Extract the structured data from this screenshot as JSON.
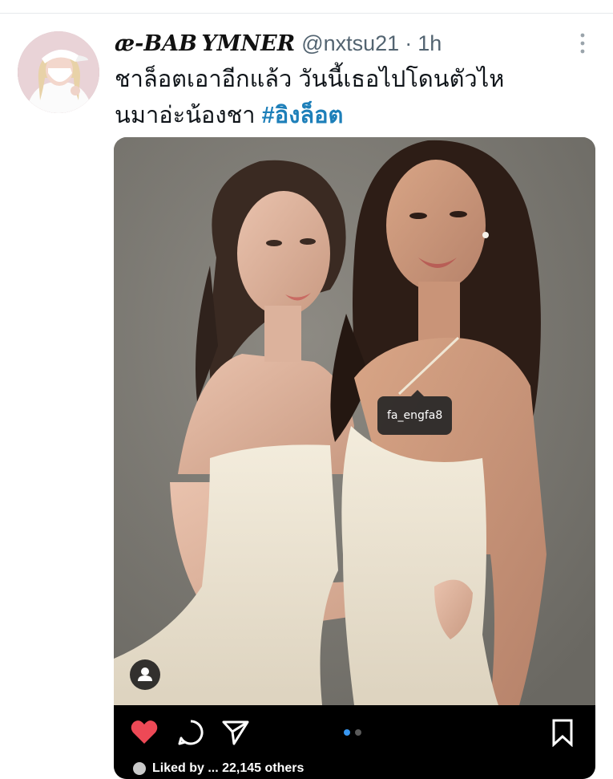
{
  "tweet": {
    "display_name": "æ-BAB YMNER",
    "handle": "@nxtsu21",
    "separator": "·",
    "time": "1h",
    "more_icon": "more-vertical-icon",
    "text_line_1": "ชาล็อตเอาอีกแล้ว วันนี้เธอไปโดนตัวไห",
    "text_line_2": "นมาอ่ะน้องชา ",
    "hashtag": "#อิงล็อต"
  },
  "media": {
    "tag_label": "fa_engfa8",
    "tag_user_icon": "person-icon",
    "icons": {
      "like": "heart-icon",
      "comment": "comment-icon",
      "share": "send-icon",
      "save": "bookmark-icon"
    },
    "carousel_total": 2,
    "carousel_active": 1,
    "likes_text": "Liked by ...   22,145 others",
    "colors": {
      "heart": "#ed4956",
      "active_dot": "#3897f0",
      "hashtag": "#1d7fb9"
    }
  }
}
